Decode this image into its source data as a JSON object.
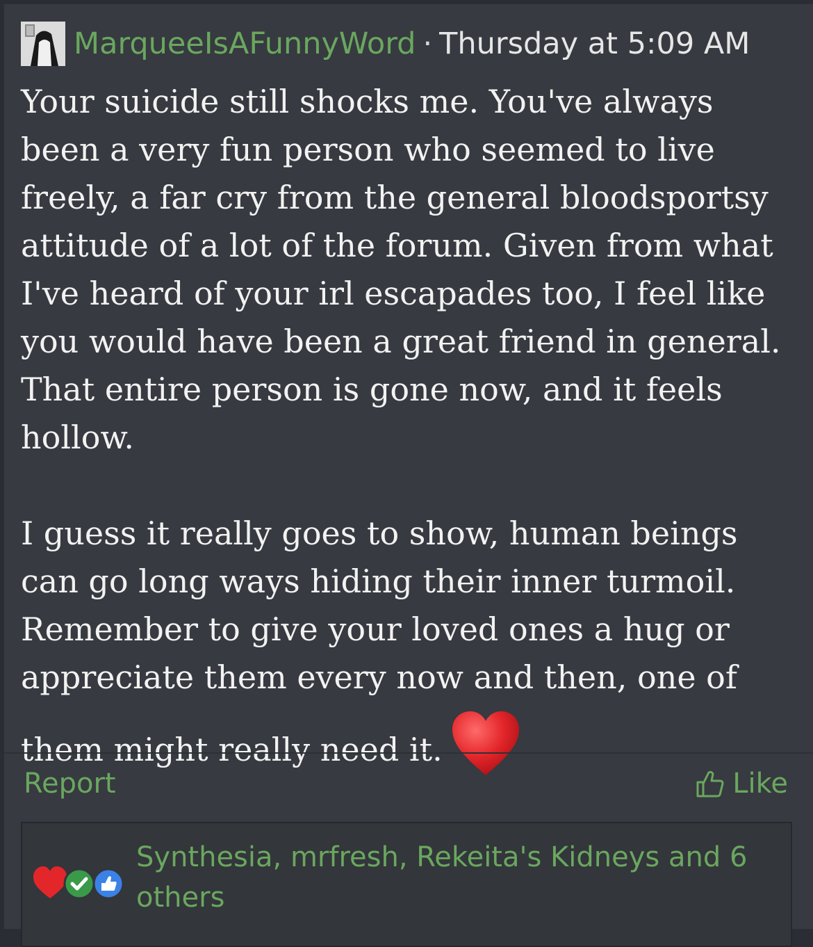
{
  "post": {
    "username": "MarqueeIsAFunnyWord",
    "separator": "·",
    "timestamp": "Thursday at 5:09 AM",
    "paragraph1": "Your suicide still shocks me. You've always been a very fun person who seemed to live freely, a far cry from the general bloodsportsy attitude of a lot of the forum. Given from what I've heard of your irl escapades too, I feel like you would have been a great friend in general. That entire person is gone now, and it feels hollow.",
    "paragraph2_main": "I guess it really goes to show, human beings can go long ways hiding their inner turmoil. Remember to give your loved ones a hug or appreciate them every now and then, one of",
    "paragraph2_end": "them might really need it.",
    "emoji": "heart-emoji"
  },
  "actions": {
    "report_label": "Report",
    "like_label": "Like"
  },
  "reactions": {
    "icons": [
      "heart-icon",
      "check-icon",
      "thumbs-up-icon"
    ],
    "summary": "Synthesia, mrfresh, Rekeita's Kidneys and 6 others"
  },
  "colors": {
    "background": "#2a2d33",
    "post_bg": "#373a40",
    "accent_green": "#6aa75f",
    "text": "#f2f2f2"
  }
}
